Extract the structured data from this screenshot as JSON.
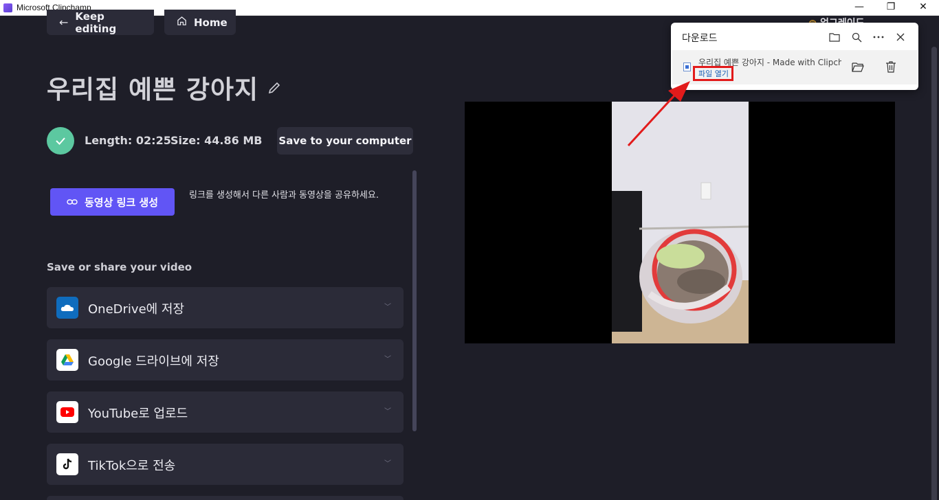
{
  "window": {
    "title": "Microsoft Clipchamp",
    "minimize": "—",
    "restore": "❐",
    "close": "✕"
  },
  "nav": {
    "keep_editing": "Keep editing",
    "home": "Home"
  },
  "project": {
    "title": "우리집 예쁜 강아지",
    "length": "Length: 02:25",
    "size": "Size: 44.86 MB",
    "save_computer": "Save to your computer"
  },
  "link": {
    "button": "동영상 링크 생성",
    "description": "링크를 생성해서 다른 사람과 동영상을 공유하세요."
  },
  "share": {
    "title": "Save or share your video",
    "items": [
      {
        "label": "OneDrive에 저장",
        "icon": "onedrive-icon"
      },
      {
        "label": "Google 드라이브에 저장",
        "icon": "google-drive-icon"
      },
      {
        "label": "YouTube로 업로드",
        "icon": "youtube-icon"
      },
      {
        "label": "TikTok으로 전송",
        "icon": "tiktok-icon"
      }
    ]
  },
  "upgrade": {
    "label": "업그레이드"
  },
  "downloads": {
    "title": "다운로드",
    "item": {
      "name": "우리집 예쁜 강아지 - Made with Clipchamp",
      "open": "파일 열기"
    }
  },
  "colors": {
    "accent": "#6155f5",
    "success": "#5cc8a0",
    "highlight": "#e21b1b"
  }
}
